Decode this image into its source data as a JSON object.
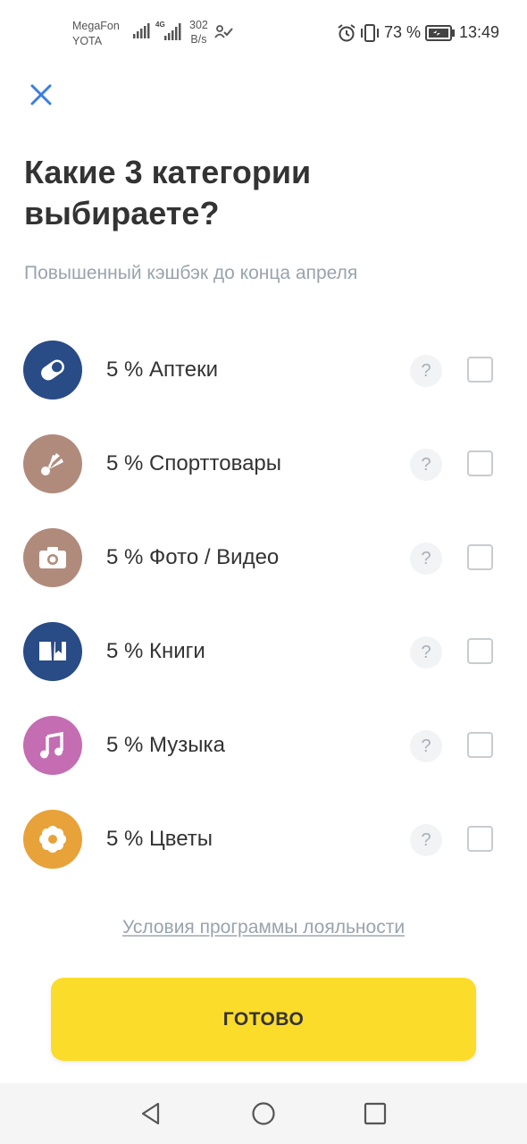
{
  "status_bar": {
    "carrier_1": "MegaFon",
    "carrier_2": "YOTA",
    "network_tag": "4G",
    "speed_value": "302",
    "speed_unit": "B/s",
    "battery": "73 %",
    "time": "13:49"
  },
  "header": {
    "title": "Какие 3 категории выбираете?",
    "subtitle": "Повышенный кэшбэк до конца апреля"
  },
  "categories": [
    {
      "label": "5 % Аптеки",
      "icon": "pill-icon",
      "color": "#294b86",
      "checked": false
    },
    {
      "label": "5 % Спорттовары",
      "icon": "shuttlecock-icon",
      "color": "#b08b7c",
      "checked": false
    },
    {
      "label": "5 % Фото / Видео",
      "icon": "camera-icon",
      "color": "#b08b7c",
      "checked": false
    },
    {
      "label": "5 % Книги",
      "icon": "book-icon",
      "color": "#294b86",
      "checked": false
    },
    {
      "label": "5 % Музыка",
      "icon": "music-note-icon",
      "color": "#c46db3",
      "checked": false
    },
    {
      "label": "5 % Цветы",
      "icon": "flower-icon",
      "color": "#e8a23a",
      "checked": false
    }
  ],
  "help_label": "?",
  "terms_link": "Условия программы лояльности",
  "done_button": "ГОТОВО",
  "colors": {
    "accent_yellow": "#fcdc2a",
    "close_blue": "#3a7ee0",
    "muted_text": "#9aa3ad"
  }
}
